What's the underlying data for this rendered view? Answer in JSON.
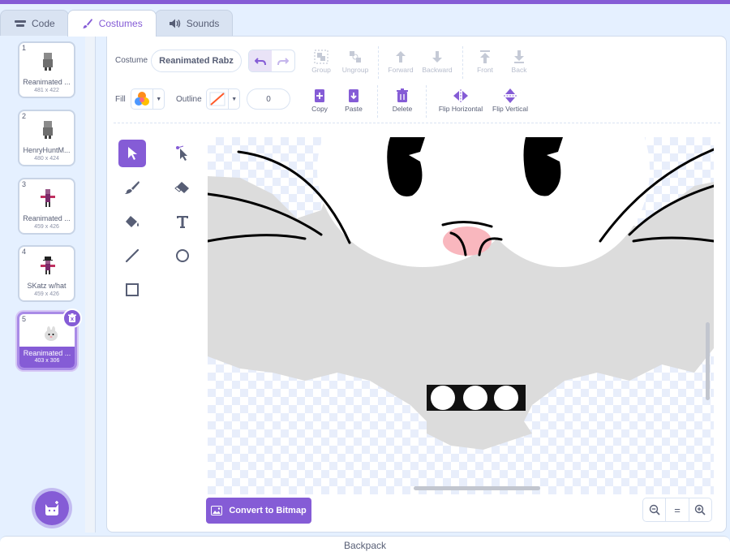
{
  "tabs": [
    {
      "label": "Code",
      "icon": "code-icon"
    },
    {
      "label": "Costumes",
      "icon": "brush-icon"
    },
    {
      "label": "Sounds",
      "icon": "speaker-icon"
    }
  ],
  "costumes": [
    {
      "num": "1",
      "name": "Reanimated ...",
      "size": "481 x 422"
    },
    {
      "num": "2",
      "name": "HenryHuntM...",
      "size": "480 x 424"
    },
    {
      "num": "3",
      "name": "Reanimated ...",
      "size": "459 x 426"
    },
    {
      "num": "4",
      "name": "SKatz w/hat",
      "size": "459 x 426"
    },
    {
      "num": "5",
      "name": "Reanimated ...",
      "size": "403 x 306"
    }
  ],
  "editor": {
    "costume_label": "Costume",
    "costume_name": "Reanimated Rabz",
    "fill_label": "Fill",
    "outline_label": "Outline",
    "outline_width": "0",
    "buttons": {
      "group": "Group",
      "ungroup": "Ungroup",
      "forward": "Forward",
      "backward": "Backward",
      "front": "Front",
      "back": "Back",
      "copy": "Copy",
      "paste": "Paste",
      "delete": "Delete",
      "flip_horizontal": "Flip Horizontal",
      "flip_vertical": "Flip Vertical"
    },
    "convert_button": "Convert to Bitmap",
    "zoom": {
      "out": "−",
      "reset": "=",
      "in": "+"
    }
  },
  "backpack": "Backpack",
  "colors": {
    "accent": "#855cd6",
    "text": "#575e75"
  }
}
